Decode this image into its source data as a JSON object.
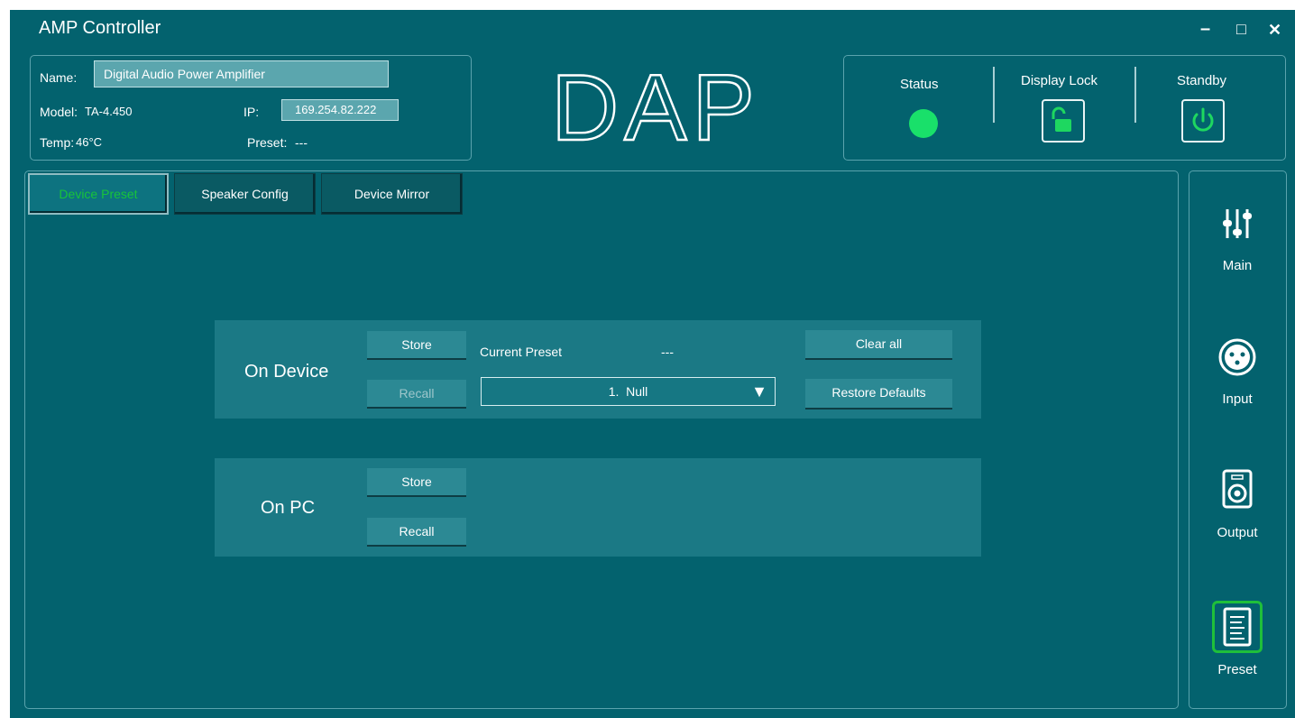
{
  "window": {
    "title": "AMP Controller",
    "controls": {
      "minimize": "–",
      "maximize": "□",
      "close": "✕"
    }
  },
  "device": {
    "name_label": "Name:",
    "name_value": "Digital Audio Power Amplifier",
    "model_label": "Model:",
    "model_value": "TA-4.450",
    "ip_label": "IP:",
    "ip_value": "169.254.82.222",
    "temp_label": "Temp:",
    "temp_value": "46°C",
    "preset_label": "Preset:",
    "preset_value": "---"
  },
  "logo": "DAP",
  "status_panel": {
    "status_label": "Status",
    "status_color": "#19e06a",
    "display_lock_label": "Display Lock",
    "display_lock_icon": "unlock-icon",
    "standby_label": "Standby",
    "standby_icon": "power-icon",
    "accent_green": "#1ed760"
  },
  "tabs": [
    {
      "label": "Device Preset",
      "active": true
    },
    {
      "label": "Speaker Config",
      "active": false
    },
    {
      "label": "Device Mirror",
      "active": false
    }
  ],
  "on_device": {
    "title": "On Device",
    "store_label": "Store",
    "recall_label": "Recall",
    "current_preset_label": "Current Preset",
    "current_preset_value": "---",
    "preset_select_value": "1.  Null",
    "clear_all_label": "Clear all",
    "restore_defaults_label": "Restore Defaults"
  },
  "on_pc": {
    "title": "On PC",
    "store_label": "Store",
    "recall_label": "Recall"
  },
  "nav": [
    {
      "label": "Main",
      "icon": "sliders-icon"
    },
    {
      "label": "Input",
      "icon": "xlr-connector-icon"
    },
    {
      "label": "Output",
      "icon": "speaker-icon"
    },
    {
      "label": "Preset",
      "icon": "document-icon",
      "active": true
    }
  ]
}
